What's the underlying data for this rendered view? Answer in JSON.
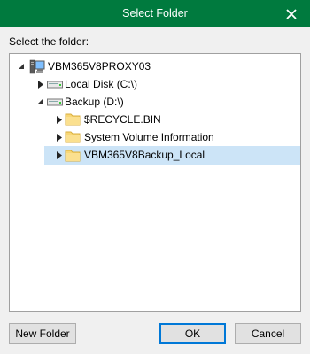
{
  "window": {
    "title": "Select Folder",
    "close_glyph": "✕"
  },
  "prompt": "Select the folder:",
  "tree": {
    "root": {
      "label": "VBM365V8PROXY03",
      "icon": "computer-icon"
    },
    "drives": [
      {
        "label": "Local Disk (C:\\)",
        "icon": "drive-icon",
        "expanded": false
      },
      {
        "label": "Backup (D:\\)",
        "icon": "drive-icon",
        "expanded": true
      }
    ],
    "folders": [
      {
        "label": "$RECYCLE.BIN",
        "icon": "folder-icon",
        "selected": false
      },
      {
        "label": "System Volume Information",
        "icon": "folder-icon",
        "selected": false
      },
      {
        "label": "VBM365V8Backup_Local",
        "icon": "folder-icon",
        "selected": true
      }
    ]
  },
  "buttons": {
    "new_folder": "New Folder",
    "ok": "OK",
    "cancel": "Cancel"
  },
  "colors": {
    "titlebar": "#007a3e",
    "selection": "#cce4f7",
    "folder": "#f8d775"
  }
}
